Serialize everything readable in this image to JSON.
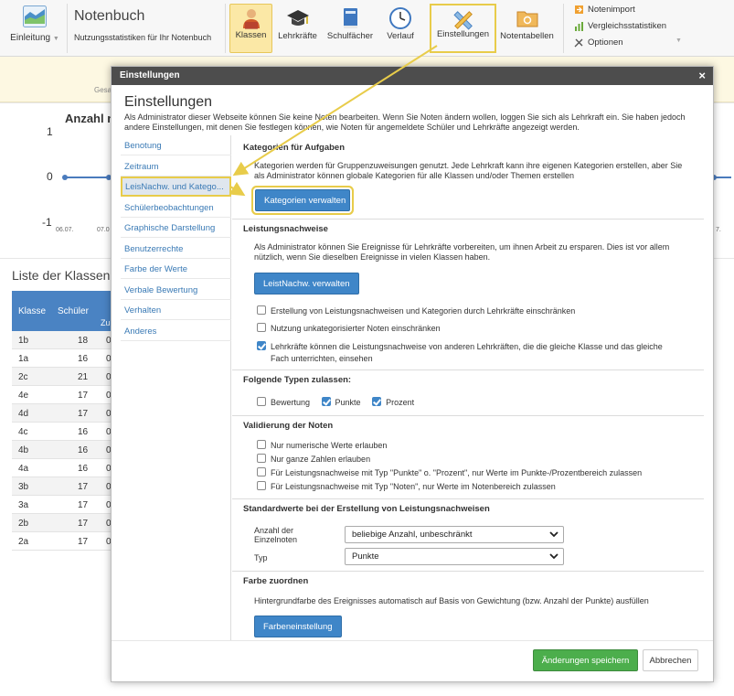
{
  "toolbar": {
    "intro_label": "Einleitung",
    "app_title": "Notenbuch",
    "app_subtitle": "Nutzungsstatistiken für Ihr Notenbuch",
    "buttons": [
      {
        "label": "Klassen",
        "icon": "users-icon"
      },
      {
        "label": "Lehrkräfte",
        "icon": "graduation-cap-icon"
      },
      {
        "label": "Schulfächer",
        "icon": "book-icon"
      },
      {
        "label": "Verlauf",
        "icon": "clock-icon"
      },
      {
        "label": "Einstellungen",
        "icon": "pencil-ruler-icon"
      },
      {
        "label": "Notentabellen",
        "icon": "folder-icon"
      }
    ],
    "side": [
      {
        "label": "Notenimport",
        "icon": "import-icon"
      },
      {
        "label": "Vergleichsstatistiken",
        "icon": "bar-chart-icon"
      },
      {
        "label": "Optionen",
        "icon": "wrench-icon"
      }
    ],
    "accent": "#fbe8a6",
    "highlight": "#e8cc4a"
  },
  "background": {
    "ges_label": "Gesa",
    "chart_title": "Anzahl n",
    "y_ticks": [
      "1",
      "0",
      "-1"
    ],
    "x_ticks": [
      "06.07.",
      "07.0",
      "7."
    ],
    "list_title": "Liste der Klassen",
    "table_headers": [
      "Klasse",
      "Schüler",
      "Zu"
    ],
    "rows": [
      {
        "klasse": "1b",
        "schueler": "18",
        "z": "0"
      },
      {
        "klasse": "1a",
        "schueler": "16",
        "z": "0"
      },
      {
        "klasse": "2c",
        "schueler": "21",
        "z": "0"
      },
      {
        "klasse": "4e",
        "schueler": "17",
        "z": "0"
      },
      {
        "klasse": "4d",
        "schueler": "17",
        "z": "0"
      },
      {
        "klasse": "4c",
        "schueler": "16",
        "z": "0"
      },
      {
        "klasse": "4b",
        "schueler": "16",
        "z": "0"
      },
      {
        "klasse": "4a",
        "schueler": "16",
        "z": "0"
      },
      {
        "klasse": "3b",
        "schueler": "17",
        "z": "0"
      },
      {
        "klasse": "3a",
        "schueler": "17",
        "z": "0"
      },
      {
        "klasse": "2b",
        "schueler": "17",
        "z": "0"
      },
      {
        "klasse": "2a",
        "schueler": "17",
        "z": "0"
      }
    ]
  },
  "modal": {
    "titlebar": "Einstellungen",
    "close": "×",
    "heading": "Einstellungen",
    "description": "Als Administrator dieser Webseite können Sie keine Noten bearbeiten. Wenn Sie Noten ändern wollen, loggen Sie sich als Lehrkraft ein. Sie haben jedoch andere Einstellungen, mit denen Sie festlegen können, wie Noten für angemeldete Schüler und Lehrkräfte angezeigt werden.",
    "nav": [
      "Benotung",
      "Zeitraum",
      "LeisNachw. und Katego...",
      "Schülerbeobachtungen",
      "Graphische Darstellung",
      "Benutzerrechte",
      "Farbe der Werte",
      "Verbale Bewertung",
      "Verhalten",
      "Anderes"
    ],
    "sections": {
      "kategorien": {
        "title": "Kategorien für Aufgaben",
        "text": "Kategorien werden für Gruppenzuweisungen genutzt. Jede Lehrkraft kann ihre eigenen Kategorien erstellen, aber Sie als Administrator können globale Kategorien für alle Klassen und/oder Themen erstellen",
        "button": "Kategorien verwalten"
      },
      "leistungsnachweise": {
        "title": "Leistungsnachweise",
        "text": "Als Administrator können Sie Ereignisse für Lehrkräfte vorbereiten, um ihnen Arbeit zu ersparen. Dies ist vor allem nützlich, wenn Sie dieselben Ereignisse in vielen Klassen haben.",
        "button": "LeistNachw. verwalten",
        "checks": [
          {
            "label": "Erstellung von Leistungsnachweisen und Kategorien durch Lehrkräfte einschränken",
            "checked": false
          },
          {
            "label": "Nutzung unkategorisierter Noten einschränken",
            "checked": false
          },
          {
            "label": "Lehrkräfte können die Leistungsnachweise von anderen Lehrkräften, die die gleiche Klasse und das gleiche Fach unterrichten, einsehen",
            "checked": true
          }
        ]
      },
      "typen": {
        "title": "Folgende Typen zulassen:",
        "options": [
          {
            "label": "Bewertung",
            "checked": false
          },
          {
            "label": "Punkte",
            "checked": true
          },
          {
            "label": "Prozent",
            "checked": true
          }
        ]
      },
      "validierung": {
        "title": "Validierung der Noten",
        "checks": [
          {
            "label": "Nur numerische Werte erlauben",
            "checked": false
          },
          {
            "label": "Nur ganze Zahlen erlauben",
            "checked": false
          },
          {
            "label": "Für Leistungsnachweise mit Typ \"Punkte\" o. \"Prozent\", nur Werte im Punkte-/Prozentbereich zulassen",
            "checked": false
          },
          {
            "label": "Für Leistungsnachweise mit Typ \"Noten\", nur Werte im Notenbereich zulassen",
            "checked": false
          }
        ]
      },
      "standard": {
        "title": "Standardwerte bei der Erstellung von Leistungsnachweisen",
        "anzahl_label": "Anzahl der Einzelnoten",
        "anzahl_value": "beliebige Anzahl, unbeschränkt",
        "typ_label": "Typ",
        "typ_value": "Punkte"
      },
      "farbe": {
        "title": "Farbe zuordnen",
        "text": "Hintergrundfarbe des Ereignisses automatisch auf Basis von Gewichtung (bzw. Anzahl der Punkte) ausfüllen",
        "button": "Farbeneinstellung"
      }
    },
    "save_button": "Änderungen speichern",
    "cancel_button": "Abbrechen"
  }
}
